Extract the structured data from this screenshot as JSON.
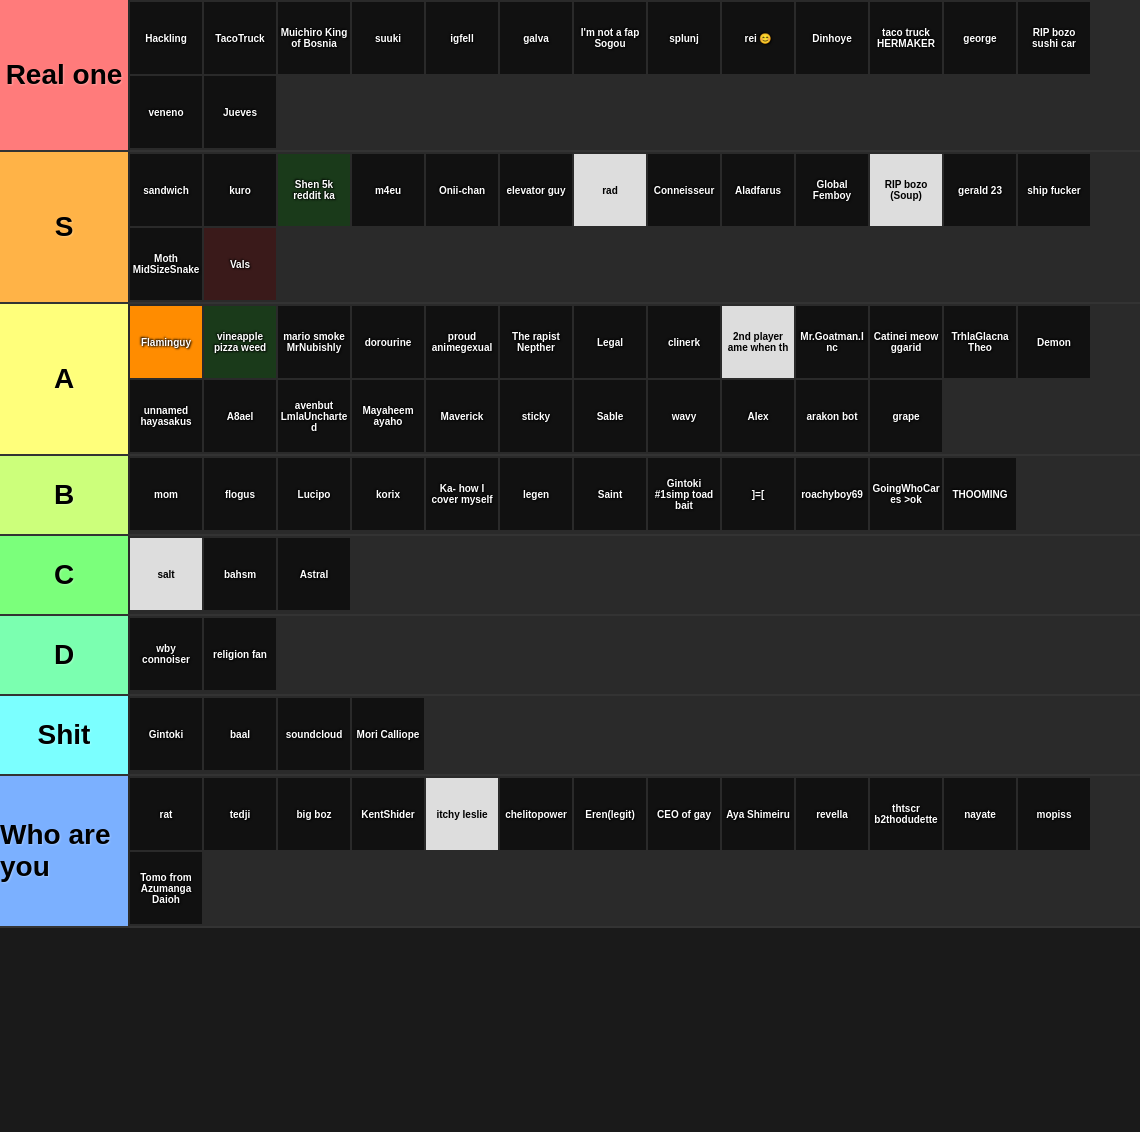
{
  "tiers": [
    {
      "id": "real",
      "label": "Real one",
      "color": "tier-real",
      "cards": [
        {
          "text": "Hackling",
          "bg": "bg-dark"
        },
        {
          "text": "TacoTruck",
          "bg": "bg-dark"
        },
        {
          "text": "Muichiro King of Bosnia",
          "bg": "bg-dark"
        },
        {
          "text": "suuki",
          "bg": "bg-dark"
        },
        {
          "text": "igfell",
          "bg": "bg-dark"
        },
        {
          "text": "galva",
          "bg": "bg-dark"
        },
        {
          "text": "I'm not a fap\nSogou",
          "bg": "bg-dark"
        },
        {
          "text": "splunj",
          "bg": "bg-dark"
        },
        {
          "text": "rei 😊",
          "bg": "bg-dark"
        },
        {
          "text": "Dinhoye",
          "bg": "bg-dark"
        },
        {
          "text": "taco truck\nHERMAKER",
          "bg": "bg-dark"
        },
        {
          "text": "george",
          "bg": "bg-dark"
        },
        {
          "text": "RIP bozo sushi car",
          "bg": "bg-dark"
        },
        {
          "text": "veneno",
          "bg": "bg-dark"
        },
        {
          "text": "Jueves",
          "bg": "bg-dark"
        }
      ]
    },
    {
      "id": "s",
      "label": "S",
      "color": "tier-s",
      "cards": [
        {
          "text": "sandwich",
          "bg": "bg-dark"
        },
        {
          "text": "kuro",
          "bg": "bg-dark"
        },
        {
          "text": "Shen\n5k reddit ka",
          "bg": "bg-green"
        },
        {
          "text": "m4eu",
          "bg": "bg-dark"
        },
        {
          "text": "Onii-chan",
          "bg": "bg-dark"
        },
        {
          "text": "elevator guy",
          "bg": "bg-dark"
        },
        {
          "text": "rad",
          "bg": "bg-white"
        },
        {
          "text": "Conneisseur",
          "bg": "bg-dark"
        },
        {
          "text": "Aladfarus",
          "bg": "bg-dark"
        },
        {
          "text": "Global Femboy",
          "bg": "bg-dark"
        },
        {
          "text": "RIP bozo\n(Soup)",
          "bg": "bg-white"
        },
        {
          "text": "gerald 23",
          "bg": "bg-dark"
        },
        {
          "text": "ship fucker",
          "bg": "bg-dark"
        },
        {
          "text": "Moth\nMidSizeSnake",
          "bg": "bg-dark"
        },
        {
          "text": "Vals",
          "bg": "bg-red"
        }
      ]
    },
    {
      "id": "a",
      "label": "A",
      "color": "tier-a",
      "cards": [
        {
          "text": "Flaminguy",
          "bg": "bg-orange"
        },
        {
          "text": "vineapple pizza weed",
          "bg": "bg-green"
        },
        {
          "text": "mario smoke\nMrNubishly",
          "bg": "bg-dark"
        },
        {
          "text": "dorourine",
          "bg": "bg-dark"
        },
        {
          "text": "proud animegexual",
          "bg": "bg-dark"
        },
        {
          "text": "The rapist\nNepther",
          "bg": "bg-dark"
        },
        {
          "text": "Legal",
          "bg": "bg-dark"
        },
        {
          "text": "clinerk",
          "bg": "bg-dark"
        },
        {
          "text": "2nd player\name when th",
          "bg": "bg-white"
        },
        {
          "text": "Mr.Goatman.Inc",
          "bg": "bg-dark"
        },
        {
          "text": "Catinei meow\nggarid",
          "bg": "bg-dark"
        },
        {
          "text": "TrhlaGlacna\nTheo",
          "bg": "bg-dark"
        },
        {
          "text": "Demon",
          "bg": "bg-dark"
        },
        {
          "text": "unnamed\nhayasakus",
          "bg": "bg-dark"
        },
        {
          "text": "A8ael",
          "bg": "bg-dark"
        },
        {
          "text": "avenbut\nLmlaUncharted",
          "bg": "bg-dark"
        },
        {
          "text": "Mayaheem\nayaho",
          "bg": "bg-dark"
        },
        {
          "text": "Maverick",
          "bg": "bg-dark"
        },
        {
          "text": "sticky",
          "bg": "bg-dark"
        },
        {
          "text": "Sable",
          "bg": "bg-dark"
        },
        {
          "text": "wavy",
          "bg": "bg-dark"
        },
        {
          "text": "Alex",
          "bg": "bg-dark"
        },
        {
          "text": "arakon bot",
          "bg": "bg-dark"
        },
        {
          "text": "grape",
          "bg": "bg-dark"
        }
      ]
    },
    {
      "id": "b",
      "label": "B",
      "color": "tier-b",
      "cards": [
        {
          "text": "mom",
          "bg": "bg-dark"
        },
        {
          "text": "flogus",
          "bg": "bg-dark"
        },
        {
          "text": "Lucipo",
          "bg": "bg-dark"
        },
        {
          "text": "korix",
          "bg": "bg-dark"
        },
        {
          "text": "Ka-\nhow I cover myself",
          "bg": "bg-dark"
        },
        {
          "text": "legen",
          "bg": "bg-dark"
        },
        {
          "text": "Saint",
          "bg": "bg-dark"
        },
        {
          "text": "Gintoki #1simp\ntoad bait",
          "bg": "bg-dark"
        },
        {
          "text": "]=[",
          "bg": "bg-dark"
        },
        {
          "text": "roachyboy69",
          "bg": "bg-dark"
        },
        {
          "text": "GoingWhoCares\n>ok",
          "bg": "bg-dark"
        },
        {
          "text": "THOOMING",
          "bg": "bg-dark"
        }
      ]
    },
    {
      "id": "c",
      "label": "C",
      "color": "tier-c",
      "cards": [
        {
          "text": "salt",
          "bg": "bg-white"
        },
        {
          "text": "bahsm",
          "bg": "bg-dark"
        },
        {
          "text": "Astral",
          "bg": "bg-dark"
        }
      ]
    },
    {
      "id": "d",
      "label": "D",
      "color": "tier-d",
      "cards": [
        {
          "text": "wby connoiser",
          "bg": "bg-dark"
        },
        {
          "text": "religion fan",
          "bg": "bg-dark"
        }
      ]
    },
    {
      "id": "shit",
      "label": "Shit",
      "color": "tier-shit",
      "cards": [
        {
          "text": "Gintoki",
          "bg": "bg-dark"
        },
        {
          "text": "baal",
          "bg": "bg-dark"
        },
        {
          "text": "soundcloud",
          "bg": "bg-dark"
        },
        {
          "text": "Mori Calliope",
          "bg": "bg-dark"
        }
      ]
    },
    {
      "id": "who",
      "label": "Who are you",
      "color": "tier-who",
      "cards": [
        {
          "text": "rat",
          "bg": "bg-dark"
        },
        {
          "text": "tedji",
          "bg": "bg-dark"
        },
        {
          "text": "big boz",
          "bg": "bg-dark"
        },
        {
          "text": "KentShider",
          "bg": "bg-dark"
        },
        {
          "text": "itchy leslie",
          "bg": "bg-white"
        },
        {
          "text": "chelitopower",
          "bg": "bg-dark"
        },
        {
          "text": "Eren(legit)",
          "bg": "bg-dark"
        },
        {
          "text": "CEO of gay",
          "bg": "bg-dark"
        },
        {
          "text": "Aya Shimeiru",
          "bg": "bg-dark"
        },
        {
          "text": "revella",
          "bg": "bg-dark"
        },
        {
          "text": "thtscr b2thodudette",
          "bg": "bg-dark"
        },
        {
          "text": "nayate",
          "bg": "bg-dark"
        },
        {
          "text": "mopiss",
          "bg": "bg-dark"
        },
        {
          "text": "Tomo from Azumanga Daioh",
          "bg": "bg-dark"
        }
      ]
    }
  ]
}
